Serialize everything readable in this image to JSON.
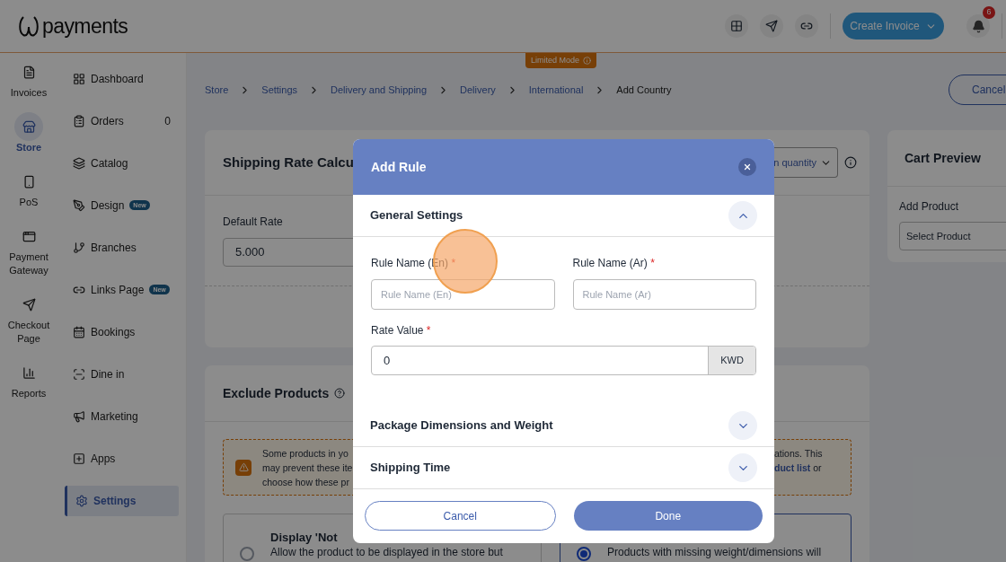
{
  "header": {
    "logo": "payments",
    "create_invoice": "Create Invoice",
    "notification_count": "6"
  },
  "limited_mode": "Limited Mode",
  "rail": [
    {
      "label": "Invoices",
      "selected": false
    },
    {
      "label": "Store",
      "selected": true
    },
    {
      "label": "PoS",
      "selected": false
    },
    {
      "label": "Payment Gateway",
      "selected": false
    },
    {
      "label": "Checkout Page",
      "selected": false
    },
    {
      "label": "Reports",
      "selected": false
    }
  ],
  "sidebar": [
    {
      "label": "Dashboard",
      "selected": false
    },
    {
      "label": "Orders",
      "selected": false,
      "count": "0"
    },
    {
      "label": "Catalog",
      "selected": false
    },
    {
      "label": "Design",
      "selected": false,
      "badge": "New"
    },
    {
      "label": "Branches",
      "selected": false
    },
    {
      "label": "Links Page",
      "selected": false,
      "badge": "New"
    },
    {
      "label": "Bookings",
      "selected": false
    },
    {
      "label": "Dine in",
      "selected": false
    },
    {
      "label": "Marketing",
      "selected": false
    },
    {
      "label": "Apps",
      "selected": false
    },
    {
      "label": "Settings",
      "selected": true
    }
  ],
  "breadcrumb": [
    "Store",
    "Settings",
    "Delivery and Shipping",
    "Delivery",
    "International",
    "Add Country"
  ],
  "cancel_button": "Cancel",
  "shipping_card": {
    "title": "Shipping Rate Calcu",
    "select_value": "n quantity",
    "default_rate_label": "Default Rate",
    "default_rate_value": "5.000"
  },
  "cart_preview": {
    "title": "Cart Preview",
    "add_product_label": "Add Product",
    "select_placeholder": "Select Product"
  },
  "exclude_products": {
    "title": "Exclude Products",
    "notice_left": [
      "Some products in yo",
      "may prevent these ite",
      "choose how these pr"
    ],
    "notice_right": [
      "ations. This",
      "**duct list** or"
    ],
    "options": [
      {
        "title": "Display 'Not",
        "description": "Allow the product to be displayed in the store but",
        "selected": false
      },
      {
        "description": "Products with missing weight/dimensions will",
        "selected": true
      }
    ]
  },
  "modal": {
    "title": "Add Rule",
    "sections": [
      {
        "title": "General Settings",
        "expanded": true
      },
      {
        "title": "Package Dimensions and Weight",
        "expanded": false
      },
      {
        "title": "Shipping Time",
        "expanded": false
      }
    ],
    "rule_name_en": {
      "label": "Rule Name (En)",
      "required_mark": "*",
      "placeholder": "Rule Name (En)"
    },
    "rule_name_ar": {
      "label": "Rule Name (Ar)",
      "required_mark": "*",
      "placeholder": "Rule Name (Ar)"
    },
    "rate_value": {
      "label": "Rate Value",
      "required_mark": "*",
      "value": "0",
      "currency": "KWD"
    },
    "cancel": "Cancel",
    "done": "Done"
  }
}
